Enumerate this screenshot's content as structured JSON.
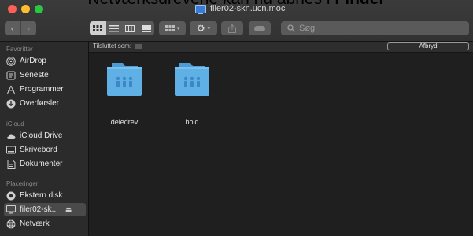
{
  "caption": {
    "text_prefix": "Netværksdrevene kan nu åbnes i ",
    "text_bold": "Finder"
  },
  "window": {
    "title": "filer02-skn.ucn.moc",
    "search_placeholder": "Søg"
  },
  "sidebar": {
    "sections": [
      {
        "label": "Favoritter"
      },
      {
        "label": "iCloud"
      },
      {
        "label": "Placeringer"
      }
    ],
    "items": [
      {
        "label": "AirDrop",
        "icon": "airdrop-icon"
      },
      {
        "label": "Seneste",
        "icon": "recents-icon"
      },
      {
        "label": "Programmer",
        "icon": "applications-icon"
      },
      {
        "label": "Overførsler",
        "icon": "downloads-icon"
      },
      {
        "label": "iCloud Drive",
        "icon": "cloud-icon"
      },
      {
        "label": "Skrivebord",
        "icon": "desktop-icon"
      },
      {
        "label": "Dokumenter",
        "icon": "document-icon"
      },
      {
        "label": "Ekstern disk",
        "icon": "disk-icon"
      },
      {
        "label": "filer02-sk...",
        "icon": "server-icon",
        "selected": true
      },
      {
        "label": "Netværk",
        "icon": "network-icon"
      }
    ]
  },
  "pathbar": {
    "connected_label": "Tilsluttet som:",
    "cancel_label": "Afbryd"
  },
  "folders": [
    {
      "name": "deledrev"
    },
    {
      "name": "hold"
    }
  ],
  "colors": {
    "folder": "#5fb0e4",
    "selected": "#4a4a4a",
    "close": "#fe5f57",
    "minimize": "#febc2e",
    "maximize": "#28c840"
  }
}
